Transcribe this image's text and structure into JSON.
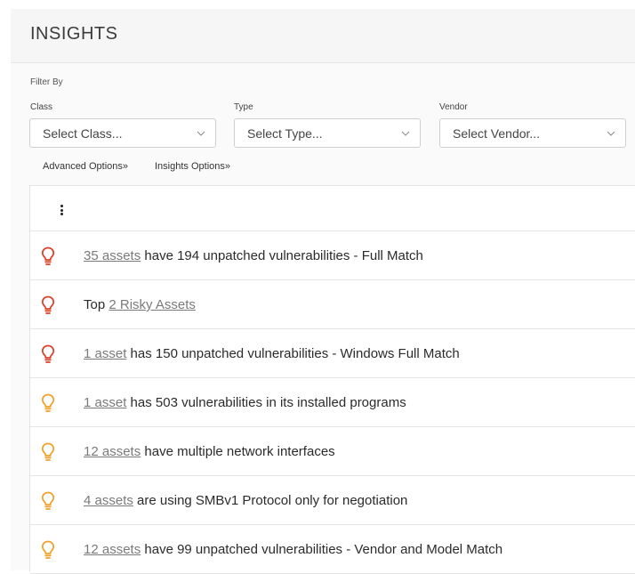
{
  "header": {
    "title": "INSIGHTS"
  },
  "filters": {
    "heading": "Filter By",
    "class": {
      "label": "Class",
      "value": "Select Class..."
    },
    "type": {
      "label": "Type",
      "value": "Select Type..."
    },
    "vendor": {
      "label": "Vendor",
      "value": "Select Vendor..."
    },
    "advanced_options": "Advanced Options»",
    "insights_options": "Insights Options»"
  },
  "colors": {
    "severity_high": "#d9432b",
    "severity_medium": "#f0a32c"
  },
  "insights": [
    {
      "severity": "high",
      "link": "35 assets",
      "text": " have 194 unpatched vulnerabilities - Full Match",
      "prefix": ""
    },
    {
      "severity": "high",
      "prefix": "Top ",
      "link": "2 Risky Assets",
      "text": ""
    },
    {
      "severity": "high",
      "link": "1 asset",
      "text": " has 150 unpatched vulnerabilities - Windows Full Match",
      "prefix": ""
    },
    {
      "severity": "medium",
      "link": "1 asset",
      "text": " has 503 vulnerabilities in its installed programs",
      "prefix": ""
    },
    {
      "severity": "medium",
      "link": "12 assets",
      "text": " have multiple network interfaces",
      "prefix": ""
    },
    {
      "severity": "medium",
      "link": "4 assets",
      "text": " are using SMBv1 Protocol only for negotiation",
      "prefix": ""
    },
    {
      "severity": "medium",
      "link": "12 assets",
      "text": " have 99 unpatched vulnerabilities - Vendor and Model Match",
      "prefix": ""
    }
  ]
}
